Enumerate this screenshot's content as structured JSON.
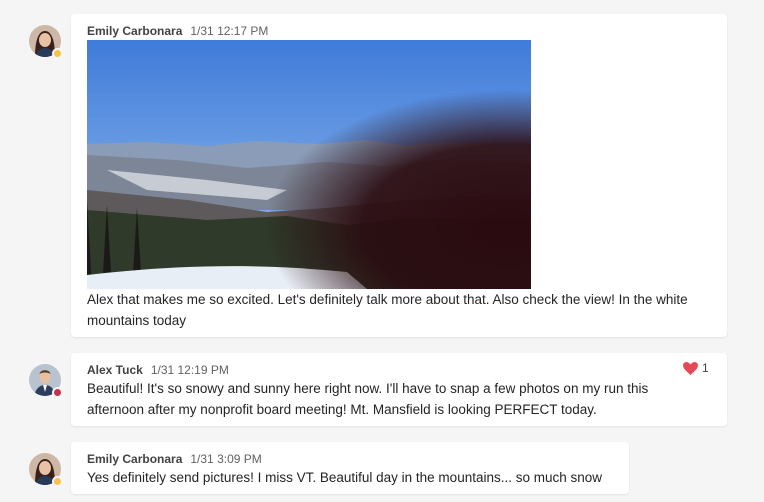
{
  "messages": [
    {
      "author": "Emily Carbonara",
      "time": "1/31 12:17 PM",
      "text": "Alex that makes me so excited. Let's definitely talk more about that. Also check the view! In the white mountains today",
      "presence": "away",
      "attachment": "mountain-photo"
    },
    {
      "author": "Alex Tuck",
      "time": "1/31 12:19 PM",
      "text": "Beautiful! It's so snowy and sunny here right now. I'll have to snap a few photos on my run this afternoon after my nonprofit board meeting! Mt. Mansfield is looking PERFECT today.",
      "presence": "busy",
      "reaction": {
        "icon": "heart-icon",
        "count": "1"
      }
    },
    {
      "author": "Emily Carbonara",
      "time": "1/31 3:09 PM",
      "text": "Yes definitely send pictures! I miss VT. Beautiful day in the mountains... so much snow",
      "presence": "away"
    }
  ]
}
